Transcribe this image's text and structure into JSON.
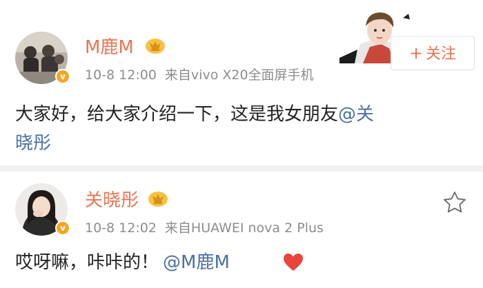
{
  "posts": [
    {
      "username": "M鹿M",
      "time": "10-8 12:00",
      "source": "来自vivo X20全面屏手机",
      "content_line1": "大家好，给大家介绍一下，这是我女朋友",
      "mention": "@关",
      "content_line2": "晓彤",
      "follow_label": "关注",
      "follow_plus": "+",
      "verified_mark": "v",
      "icons": [
        "avatar",
        "verified-badge-icon",
        "crown-icon",
        "sticker-character",
        "plus-icon"
      ]
    },
    {
      "username": "关晓彤",
      "time": "10-8 12:02",
      "source": "来自HUAWEI nova 2 Plus",
      "content_text": "哎呀嘛，咔咔的！",
      "mention": "@M鹿M",
      "verified_mark": "v",
      "icons": [
        "avatar",
        "verified-badge-icon",
        "crown-icon",
        "star-icon",
        "heart-icon"
      ]
    }
  ],
  "colors": {
    "username": "#eb7350",
    "meta": "#8c8c8c",
    "mention": "#4a6fa5",
    "badge": "#f4a623",
    "heart": "#e8453c"
  }
}
